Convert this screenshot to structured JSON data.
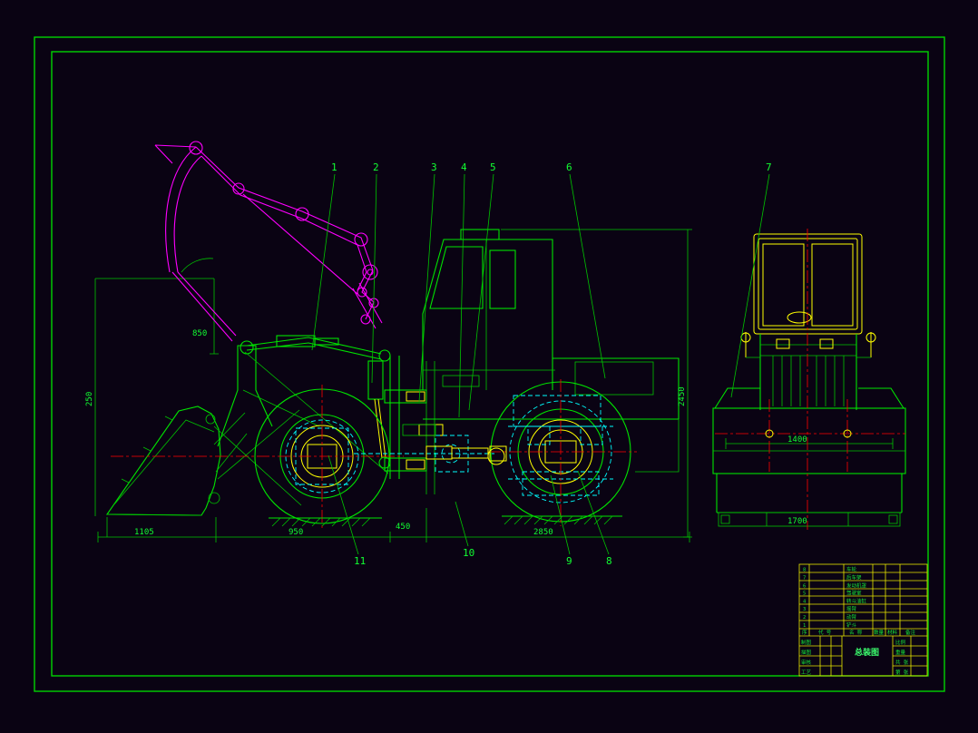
{
  "palette": {
    "background": "#0a0313",
    "frame_green": "#00d400",
    "outline_green": "#00e400",
    "mechanism_magenta": "#ff00ff",
    "hidden_cyan": "#00ffff",
    "centerline_red": "#ff0000",
    "detail_yellow": "#ffff00"
  },
  "callouts": {
    "c1": "1",
    "c2": "2",
    "c3": "3",
    "c4": "4",
    "c5": "5",
    "c6": "6",
    "c7": "7",
    "c8": "8",
    "c9": "9",
    "c10": "10",
    "c11": "11"
  },
  "dimensions": {
    "left_height": "250",
    "left_upper": "850",
    "bucket_reach": "1105",
    "front_overhang": "950",
    "mid": "450",
    "wheelbase": "2850",
    "overall_height": "2450",
    "front_width": "1400",
    "overall_width": "1700"
  },
  "title_block": {
    "title": "总装图",
    "bom_headers": {
      "no": "序",
      "code": "代 号",
      "name": "名 称",
      "qty": "数量",
      "mat": "材料",
      "note": "备注"
    },
    "bom_nos": [
      "8",
      "7",
      "6",
      "5",
      "4",
      "3",
      "2",
      "1"
    ],
    "bom_rows": [
      "车轮",
      "后车架",
      "发动机罩",
      "驾驶室",
      "转斗油缸",
      "摇臂",
      "动臂",
      "铲斗"
    ],
    "labels": {
      "draw": "制图",
      "trace": "描图",
      "check": "审核",
      "craft": "工艺",
      "scale": "比例",
      "weight": "重量",
      "sheet_total": "共 张",
      "sheet_no": "第 张"
    }
  }
}
